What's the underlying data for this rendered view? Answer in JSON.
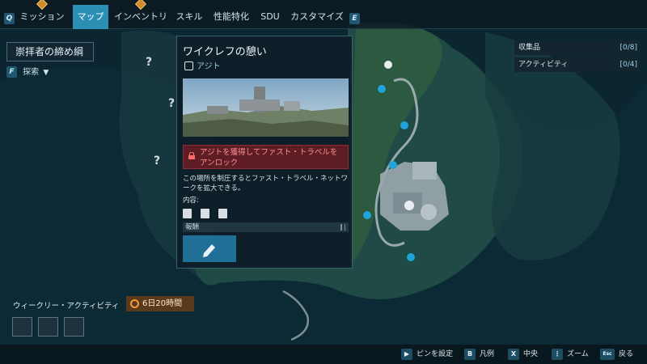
{
  "nav": {
    "left_key": "Q",
    "right_key": "E",
    "tabs": [
      {
        "label": "ミッション",
        "active": false,
        "badge": true
      },
      {
        "label": "マップ",
        "active": true,
        "badge": false
      },
      {
        "label": "インベントリ",
        "active": false,
        "badge": true
      },
      {
        "label": "スキル",
        "active": false,
        "badge": false
      },
      {
        "label": "性能特化",
        "active": false,
        "badge": false
      },
      {
        "label": "SDU",
        "active": false,
        "badge": false
      },
      {
        "label": "カスタマイズ",
        "active": false,
        "badge": false
      }
    ]
  },
  "region": {
    "title": "崇拝者の締め綱"
  },
  "explore": {
    "key": "F",
    "label": "探索"
  },
  "card": {
    "title": "ワイクレフの憩い",
    "type": "アジト",
    "lock_text": "アジトを獲得してファスト・トラベルをアンロック",
    "description": "この場所を制圧するとファスト・トラベル・ネットワークを拡大できる。",
    "contents_label": "内容:",
    "reward_label": "報酬"
  },
  "right_panel": {
    "rows": [
      {
        "label": "収集品",
        "count": "[0/8]"
      },
      {
        "label": "アクティビティ",
        "count": "[0/4]"
      }
    ]
  },
  "weekly": {
    "label": "ウィークリー・アクティビティ",
    "timer": "6日20時間"
  },
  "bottom": {
    "hints": [
      {
        "key": "▶",
        "label": "ピンを設定"
      },
      {
        "key": "B",
        "label": "凡例"
      },
      {
        "key": "X",
        "label": "中央"
      },
      {
        "key": "⋮",
        "label": "ズーム"
      },
      {
        "key": "Esc",
        "label": "戻る"
      }
    ]
  },
  "colors": {
    "accent": "#2a8fb3",
    "lock_bg": "#5e1d24",
    "timer_bg": "#5a3a1c"
  }
}
